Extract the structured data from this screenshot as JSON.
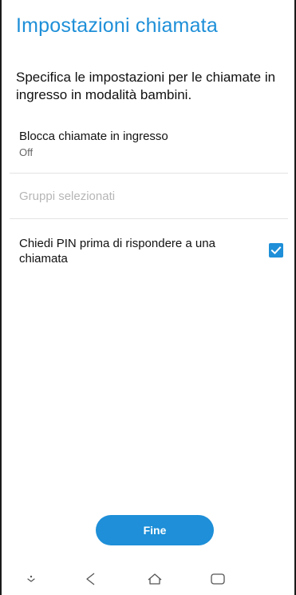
{
  "header": {
    "title": "Impostazioni chiamata"
  },
  "description": "Specifica le impostazioni per le chiamate in ingresso in modalità bambini.",
  "settings": {
    "block_calls": {
      "title": "Blocca chiamate in ingresso",
      "value": "Off"
    },
    "selected_groups": {
      "label": "Gruppi selezionati",
      "enabled": false
    },
    "ask_pin": {
      "label": "Chiedi PIN prima di rispondere a una chiamata",
      "checked": true
    }
  },
  "actions": {
    "done_label": "Fine"
  },
  "navbar": {
    "icons": [
      "more-icon",
      "back-icon",
      "home-icon",
      "recent-apps-icon"
    ]
  },
  "colors": {
    "accent": "#1e8fd8",
    "text_primary": "#111111",
    "text_secondary": "#666666",
    "text_disabled": "#b6b6b6",
    "divider": "#e3e3e3"
  }
}
